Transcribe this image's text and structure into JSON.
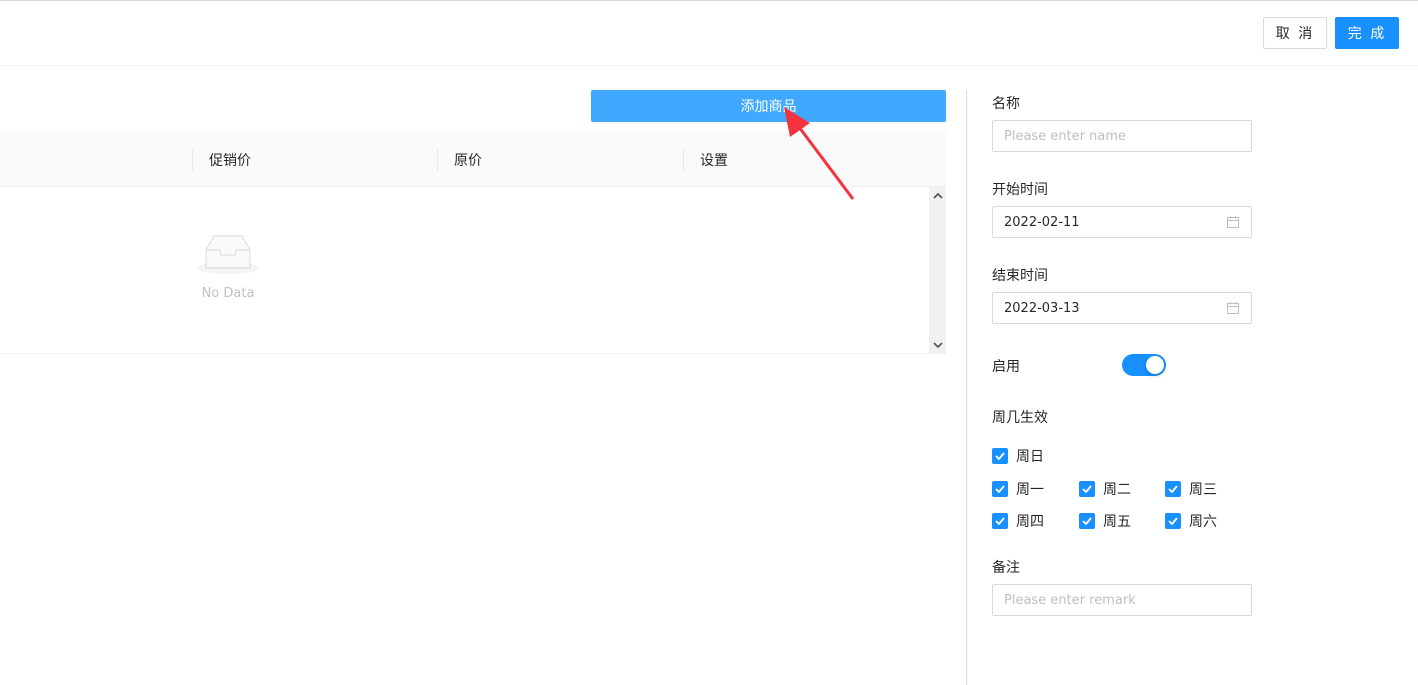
{
  "header": {
    "cancel_label": "取 消",
    "done_label": "完 成"
  },
  "products": {
    "add_button_label": "添加商品",
    "columns": [
      "促销价",
      "原价",
      "设置"
    ],
    "empty_text": "No Data"
  },
  "form": {
    "name": {
      "label": "名称",
      "placeholder": "Please enter name"
    },
    "start_time": {
      "label": "开始时间",
      "value": "2022-02-11"
    },
    "end_time": {
      "label": "结束时间",
      "value": "2022-03-13"
    },
    "enabled": {
      "label": "启用",
      "on": true
    },
    "weekdays": {
      "label": "周几生效",
      "items": [
        "周日",
        "周一",
        "周二",
        "周三",
        "周四",
        "周五",
        "周六"
      ],
      "checked": [
        true,
        true,
        true,
        true,
        true,
        true,
        true
      ]
    },
    "remark": {
      "label": "备注",
      "placeholder": "Please enter remark"
    }
  },
  "colors": {
    "primary": "#1890ff",
    "add_button": "#40a9ff",
    "annotation_arrow": "#f5333f"
  }
}
